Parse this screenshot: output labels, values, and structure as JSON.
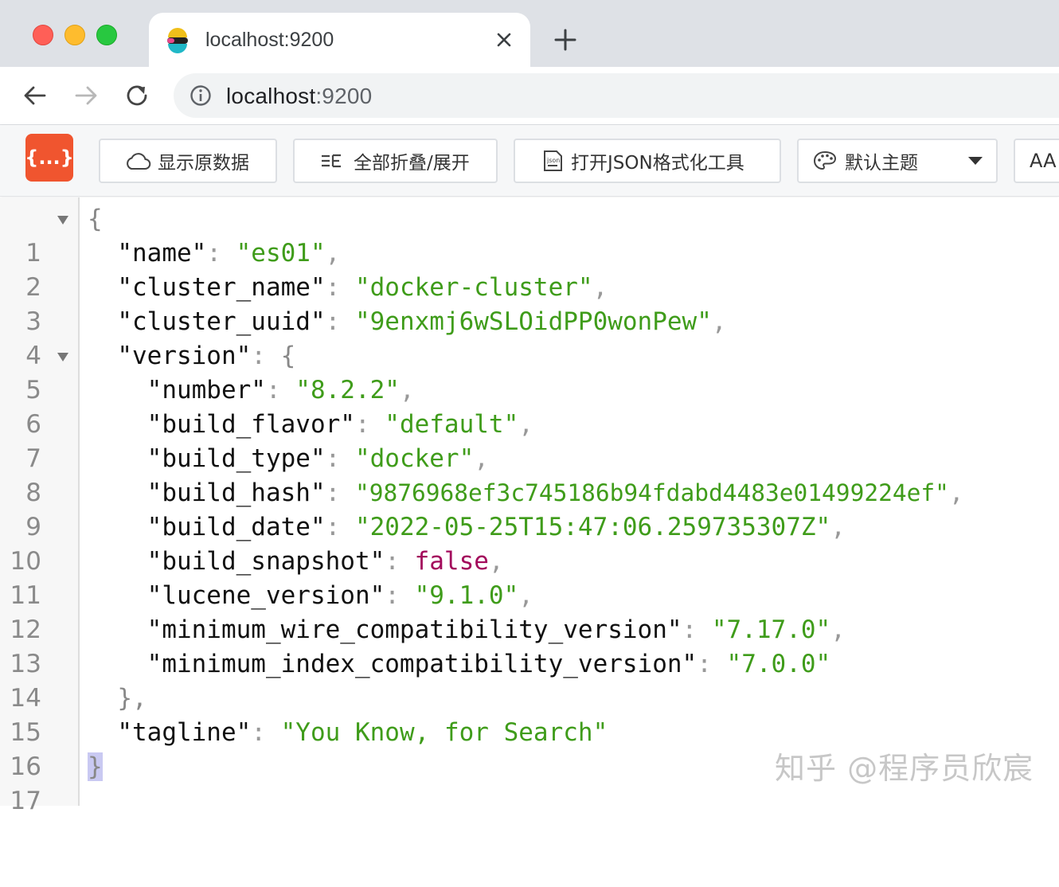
{
  "browser": {
    "tab_title": "localhost:9200",
    "url_host": "localhost",
    "url_port": ":9200",
    "icons": {
      "traffic_lights": [
        "close-dot",
        "minimize-dot",
        "maximize-dot"
      ],
      "tab_favicon": "elastic-logo-icon",
      "tab_close": "close-icon",
      "new_tab": "plus-icon",
      "back": "arrow-left-icon",
      "forward": "arrow-right-icon",
      "reload": "reload-icon",
      "site_info": "info-icon"
    }
  },
  "extension": {
    "logo_text": "{...}",
    "buttons": {
      "raw": "显示原数据",
      "fold": "全部折叠/展开",
      "tool": "打开JSON格式化工具",
      "theme": "默认主题",
      "font": "AA"
    },
    "icons": {
      "raw": "cloud-icon",
      "fold": "collapse-list-icon",
      "tool": "json-file-icon",
      "theme": "palette-icon",
      "theme_caret": "caret-down-icon",
      "font": "font-size-icon"
    },
    "accent_color": "#f0552f"
  },
  "code": {
    "line_numbers": [
      "1",
      "2",
      "3",
      "4",
      "5",
      "6",
      "7",
      "8",
      "9",
      "10",
      "11",
      "12",
      "13",
      "14",
      "15",
      "16",
      "17"
    ],
    "open_brace": "{",
    "close_brace": "}",
    "close_version": "},",
    "colon": ": ",
    "comma": ",",
    "fields": {
      "name": {
        "key": "\"name\"",
        "value": "\"es01\""
      },
      "cluster_name": {
        "key": "\"cluster_name\"",
        "value": "\"docker-cluster\""
      },
      "cluster_uuid": {
        "key": "\"cluster_uuid\"",
        "value": "\"9enxmj6wSLOidPP0wonPew\""
      },
      "version": {
        "key": "\"version\""
      },
      "number": {
        "key": "\"number\"",
        "value": "\"8.2.2\""
      },
      "build_flavor": {
        "key": "\"build_flavor\"",
        "value": "\"default\""
      },
      "build_type": {
        "key": "\"build_type\"",
        "value": "\"docker\""
      },
      "build_hash": {
        "key": "\"build_hash\"",
        "value": "\"9876968ef3c745186b94fdabd4483e01499224ef\""
      },
      "build_date": {
        "key": "\"build_date\"",
        "value": "\"2022-05-25T15:47:06.259735307Z\""
      },
      "build_snapshot": {
        "key": "\"build_snapshot\"",
        "value": "false"
      },
      "lucene_version": {
        "key": "\"lucene_version\"",
        "value": "\"9.1.0\""
      },
      "minimum_wire_compatibility_version": {
        "key": "\"minimum_wire_compatibility_version\"",
        "value": "\"7.17.0\""
      },
      "minimum_index_compatibility_version": {
        "key": "\"minimum_index_compatibility_version\"",
        "value": "\"7.0.0\""
      },
      "tagline": {
        "key": "\"tagline\"",
        "value": "\"You Know, for Search\""
      }
    },
    "colors": {
      "key": "#111111",
      "string": "#3f9c1a",
      "boolean": "#a30a5c",
      "punctuation": "#999999"
    }
  },
  "watermark": "知乎 @程序员欣宸"
}
